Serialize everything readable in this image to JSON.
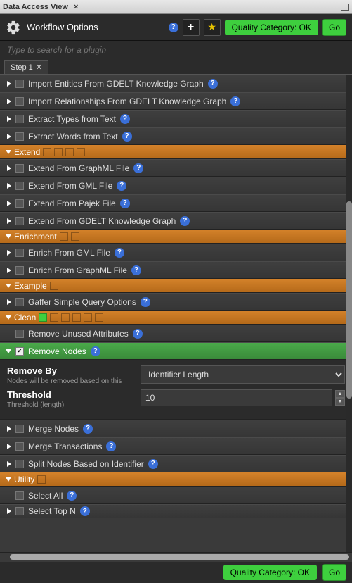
{
  "title": "Data Access View",
  "toolbar": {
    "workflow_label": "Workflow Options",
    "quality_label": "Quality Category: OK",
    "go_label": "Go"
  },
  "search": {
    "placeholder": "Type to search for a plugin"
  },
  "tab": {
    "label": "Step 1"
  },
  "rows": {
    "r1": "Import Entities From GDELT Knowledge Graph",
    "r2": "Import Relationships From GDELT Knowledge Graph",
    "r3": "Extract Types from Text",
    "r4": "Extract Words from Text",
    "r5": "Extend From GraphML File",
    "r6": "Extend From GML File",
    "r7": "Extend From Pajek File",
    "r8": "Extend From GDELT Knowledge Graph",
    "r9": "Enrich From GML File",
    "r10": "Enrich From GraphML File",
    "r11": "Gaffer Simple Query Options",
    "r12": "Remove Unused Attributes",
    "r13": "Remove Nodes",
    "r14": "Merge Nodes",
    "r15": "Merge Transactions",
    "r16": "Split Nodes Based on Identifier",
    "r17": "Select All",
    "r18": "Select Top N"
  },
  "categories": {
    "extend": "Extend",
    "enrichment": "Enrichment",
    "example": "Example",
    "clean": "Clean",
    "utility": "Utility"
  },
  "form": {
    "remove_by_label": "Remove By",
    "remove_by_sub": "Nodes will be removed based on this",
    "remove_by_value": "Identifier Length",
    "threshold_label": "Threshold",
    "threshold_sub": "Threshold (length)",
    "threshold_value": "10"
  },
  "footer": {
    "quality_label": "Quality Category: OK",
    "go_label": "Go"
  }
}
